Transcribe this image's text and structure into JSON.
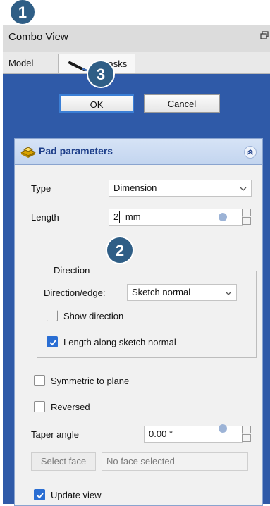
{
  "window": {
    "title": "Combo View"
  },
  "tabs": {
    "model": "Model",
    "tasks": "Tasks"
  },
  "dialog_buttons": {
    "ok": "OK",
    "cancel": "Cancel"
  },
  "section": {
    "title": "Pad parameters"
  },
  "fields": {
    "type_label": "Type",
    "type_value": "Dimension",
    "length_label": "Length",
    "length_value": "2",
    "length_unit": "mm",
    "direction_group": "Direction",
    "direction_edge_label": "Direction/edge:",
    "direction_edge_value": "Sketch normal",
    "show_direction": "Show direction",
    "length_along_normal": "Length along sketch normal",
    "symmetric": "Symmetric to plane",
    "reversed": "Reversed",
    "taper_label": "Taper angle",
    "taper_value": "0.00 °",
    "select_face": "Select face",
    "face_placeholder": "No face selected",
    "update_view": "Update view"
  },
  "checkboxes": {
    "show_direction": false,
    "length_along_normal": true,
    "symmetric": false,
    "reversed": false,
    "update_view": true
  },
  "badges": {
    "one": "1",
    "two": "2",
    "three": "3"
  },
  "colors": {
    "accent": "#2a6ed3",
    "panel_bg": "#2f5aa8",
    "badge": "#2f5e86"
  }
}
